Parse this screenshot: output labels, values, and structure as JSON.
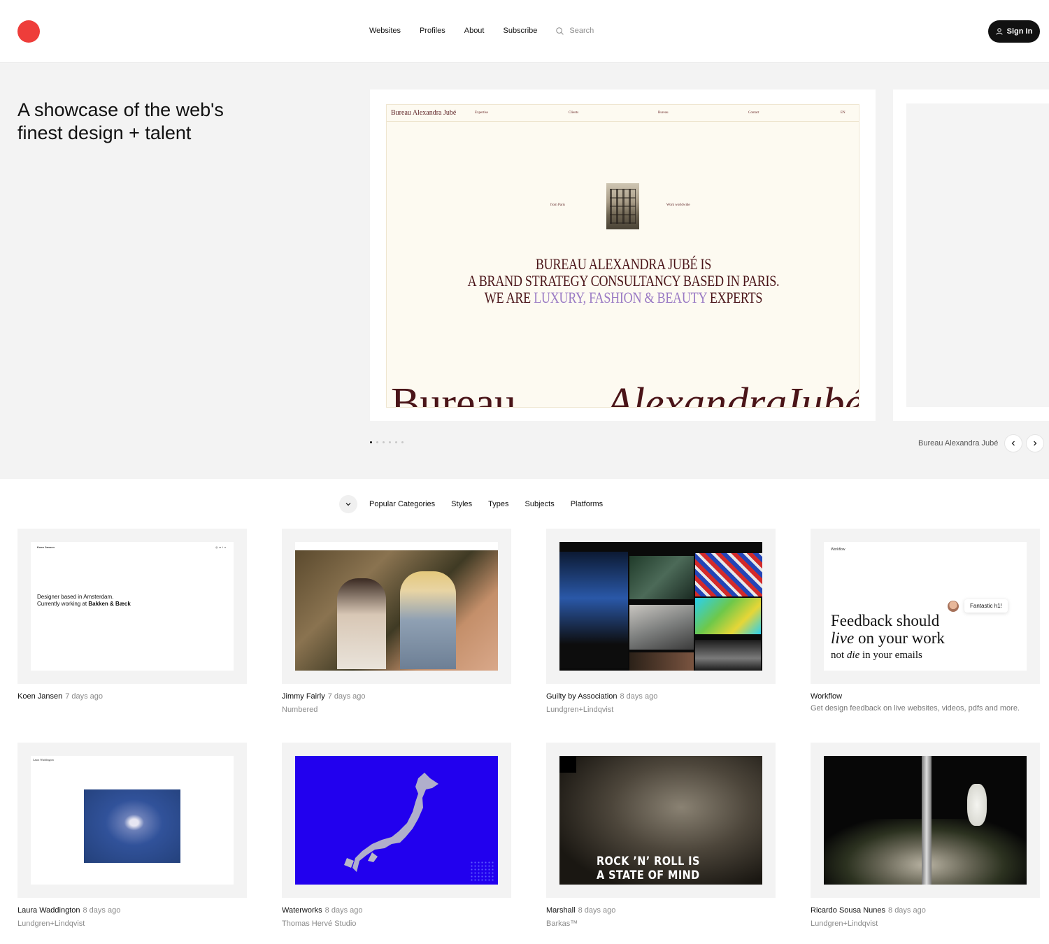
{
  "header": {
    "nav": [
      "Websites",
      "Profiles",
      "About",
      "Subscribe"
    ],
    "search_placeholder": "Search",
    "signin_label": "Sign In"
  },
  "hero": {
    "title_line1": "A showcase of the web's",
    "title_line2": "finest design + talent",
    "slide_caption": "Bureau Alexandra Jubé",
    "slide_count": 6,
    "active_slide": 1,
    "slide": {
      "brand": "Bureau Alexandra Jubé",
      "nav": [
        "Expertise",
        "Clients",
        "Bureau",
        "Contact",
        "EN"
      ],
      "from": "from Paris",
      "worldwide": "Work worldwide",
      "headline_line1": "BUREAU ALEXANDRA JUBÉ IS",
      "headline_line2": "A BRAND STRATEGY CONSULTANCY BASED IN PARIS.",
      "headline_line3_pre": "WE ARE ",
      "headline_line3_accent": "LUXURY, FASHION & BEAUTY",
      "headline_line3_post": " EXPERTS",
      "big_word1": "Bureau",
      "big_word2": "Alexandra",
      "big_word3": "Jubé"
    }
  },
  "filters": [
    "Popular Categories",
    "Styles",
    "Types",
    "Subjects",
    "Platforms"
  ],
  "cards": [
    {
      "name": "Koen Jansen",
      "ago": "7 days ago",
      "sub": "",
      "bio_line1": "Designer based in Amsterdam.",
      "bio_line2_pre": "Currently working at ",
      "bio_line2_bold": "Bakken & Bæck"
    },
    {
      "name": "Jimmy Fairly",
      "ago": "7 days ago",
      "sub": "Numbered"
    },
    {
      "name": "Guilty by Association",
      "ago": "8 days ago",
      "sub": "Lundgren+Lindqvist"
    },
    {
      "name": "Workflow",
      "ago": "",
      "sub": "Get design feedback on live websites, videos, pdfs and more.",
      "headline_line1": "Feedback should",
      "headline_line2_it": "live",
      "headline_line2": " on your work",
      "headline_line3_pre": "not ",
      "headline_line3_it": "die",
      "headline_line3_post": " in your emails",
      "bubble": "Fantastic h1!"
    },
    {
      "name": "Laura Waddington",
      "ago": "8 days ago",
      "sub": "Lundgren+Lindqvist"
    },
    {
      "name": "Waterworks",
      "ago": "8 days ago",
      "sub": "Thomas Hervé Studio"
    },
    {
      "name": "Marshall",
      "ago": "8 days ago",
      "sub": "Barkas™",
      "tagline_line1": "ROCK ’N’ ROLL IS",
      "tagline_line2": "A STATE OF MIND"
    },
    {
      "name": "Ricardo Sousa Nunes",
      "ago": "8 days ago",
      "sub": "Lundgren+Lindqvist"
    }
  ]
}
